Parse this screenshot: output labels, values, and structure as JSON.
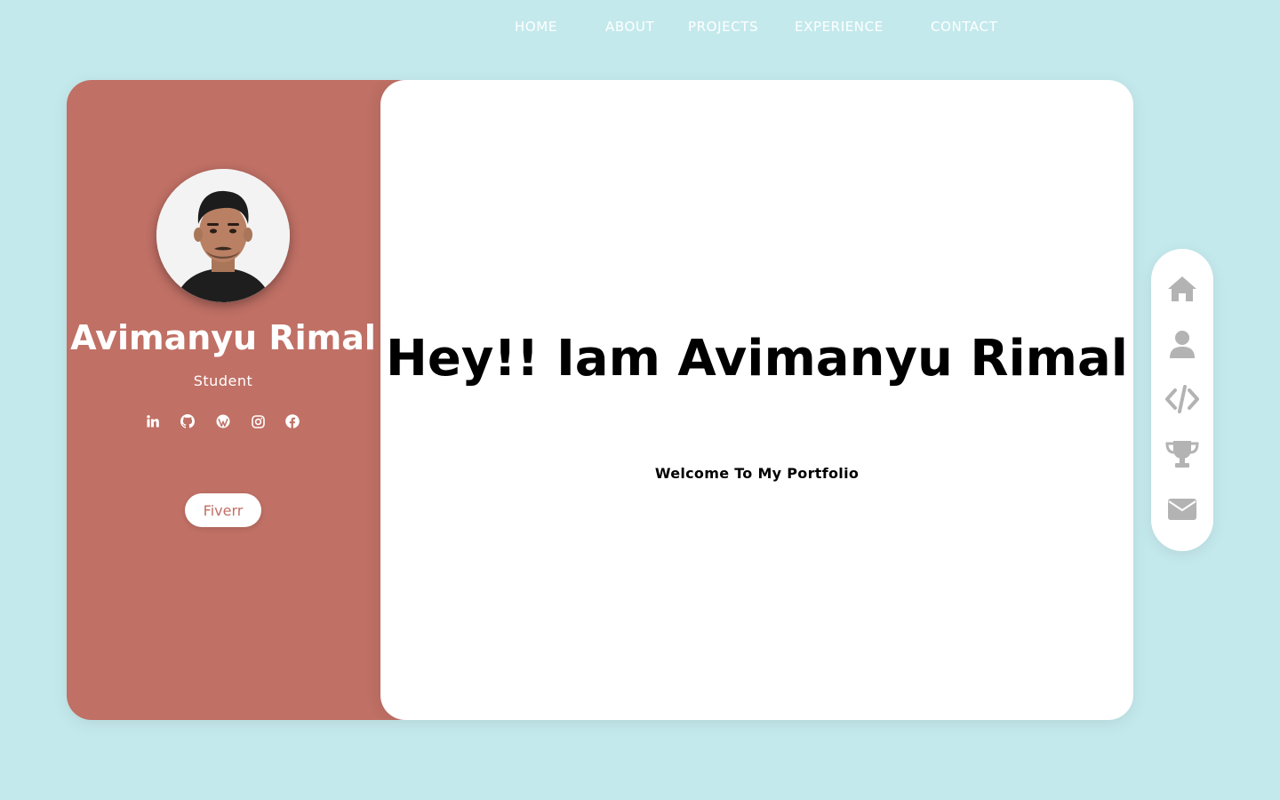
{
  "nav": {
    "home": "HOME",
    "about": "ABOUT",
    "projects": "PROJECTS",
    "experience": "EXPERIENCE",
    "contact": "CONTACT"
  },
  "profile": {
    "name": "Avimanyu Rimal",
    "role": "Student",
    "socials": [
      "linkedin-icon",
      "github-icon",
      "wordpress-icon",
      "instagram-icon",
      "facebook-icon"
    ],
    "fiverr_label": "Fiverr"
  },
  "hero": {
    "title": "Hey!! Iam Avimanyu Rimal",
    "subtitle": "Welcome To My Portfolio"
  },
  "side_nav": [
    "home-icon",
    "user-icon",
    "code-icon",
    "trophy-icon",
    "envelope-icon"
  ],
  "colors": {
    "background": "#c4e9ec",
    "profile_panel": "#c07065",
    "content_panel": "#ffffff",
    "side_icon": "#b3b3b3"
  }
}
